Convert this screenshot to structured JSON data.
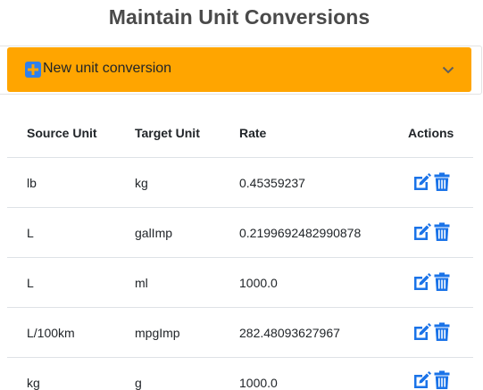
{
  "page": {
    "title": "Maintain Unit Conversions"
  },
  "accordion": {
    "label": "New unit conversion",
    "expanded": false,
    "icon": "plus-square-icon",
    "toggle_icon": "chevron-down-icon",
    "color": "#ffa500"
  },
  "table": {
    "headers": {
      "source": "Source Unit",
      "target": "Target Unit",
      "rate": "Rate",
      "actions": "Actions"
    },
    "rows": [
      {
        "source": "lb",
        "target": "kg",
        "rate": "0.45359237"
      },
      {
        "source": "L",
        "target": "galImp",
        "rate": "0.2199692482990878"
      },
      {
        "source": "L",
        "target": "ml",
        "rate": "1000.0"
      },
      {
        "source": "L/100km",
        "target": "mpgImp",
        "rate": "282.48093627967"
      },
      {
        "source": "kg",
        "target": "g",
        "rate": "1000.0"
      }
    ],
    "action_icons": [
      "edit-icon",
      "trash-icon"
    ],
    "action_color": "#1a73e8"
  }
}
